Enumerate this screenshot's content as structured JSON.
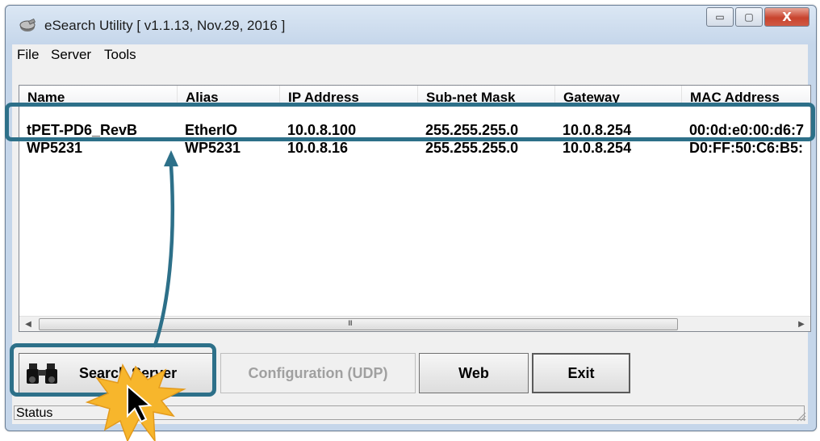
{
  "window": {
    "title": "eSearch Utility [ v1.1.13, Nov.29, 2016 ]",
    "controls": {
      "minimize": "▭",
      "maximize": "▢",
      "close": "X"
    }
  },
  "menu": [
    "File",
    "Server",
    "Tools"
  ],
  "table": {
    "columns": [
      "Name",
      "Alias",
      "IP Address",
      "Sub-net Mask",
      "Gateway",
      "MAC Address"
    ],
    "rows": [
      [
        "tPET-PD6_RevB",
        "EtherIO",
        "10.0.8.100",
        "255.255.255.0",
        "10.0.8.254",
        "00:0d:e0:00:d6:7"
      ],
      [
        "WP5231",
        "WP5231",
        "10.0.8.16",
        "255.255.255.0",
        "10.0.8.254",
        "D0:FF:50:C6:B5:"
      ]
    ]
  },
  "scrollbar": {
    "left_arrow": "◀",
    "right_arrow": "▶",
    "grip": "III"
  },
  "buttons": {
    "search": "Search Server",
    "config": "Configuration (UDP)",
    "web": "Web",
    "exit": "Exit"
  },
  "status": {
    "text": "Status"
  },
  "annotation": {
    "accent_color": "#2d7089",
    "starburst_color": "#f7b62c"
  }
}
